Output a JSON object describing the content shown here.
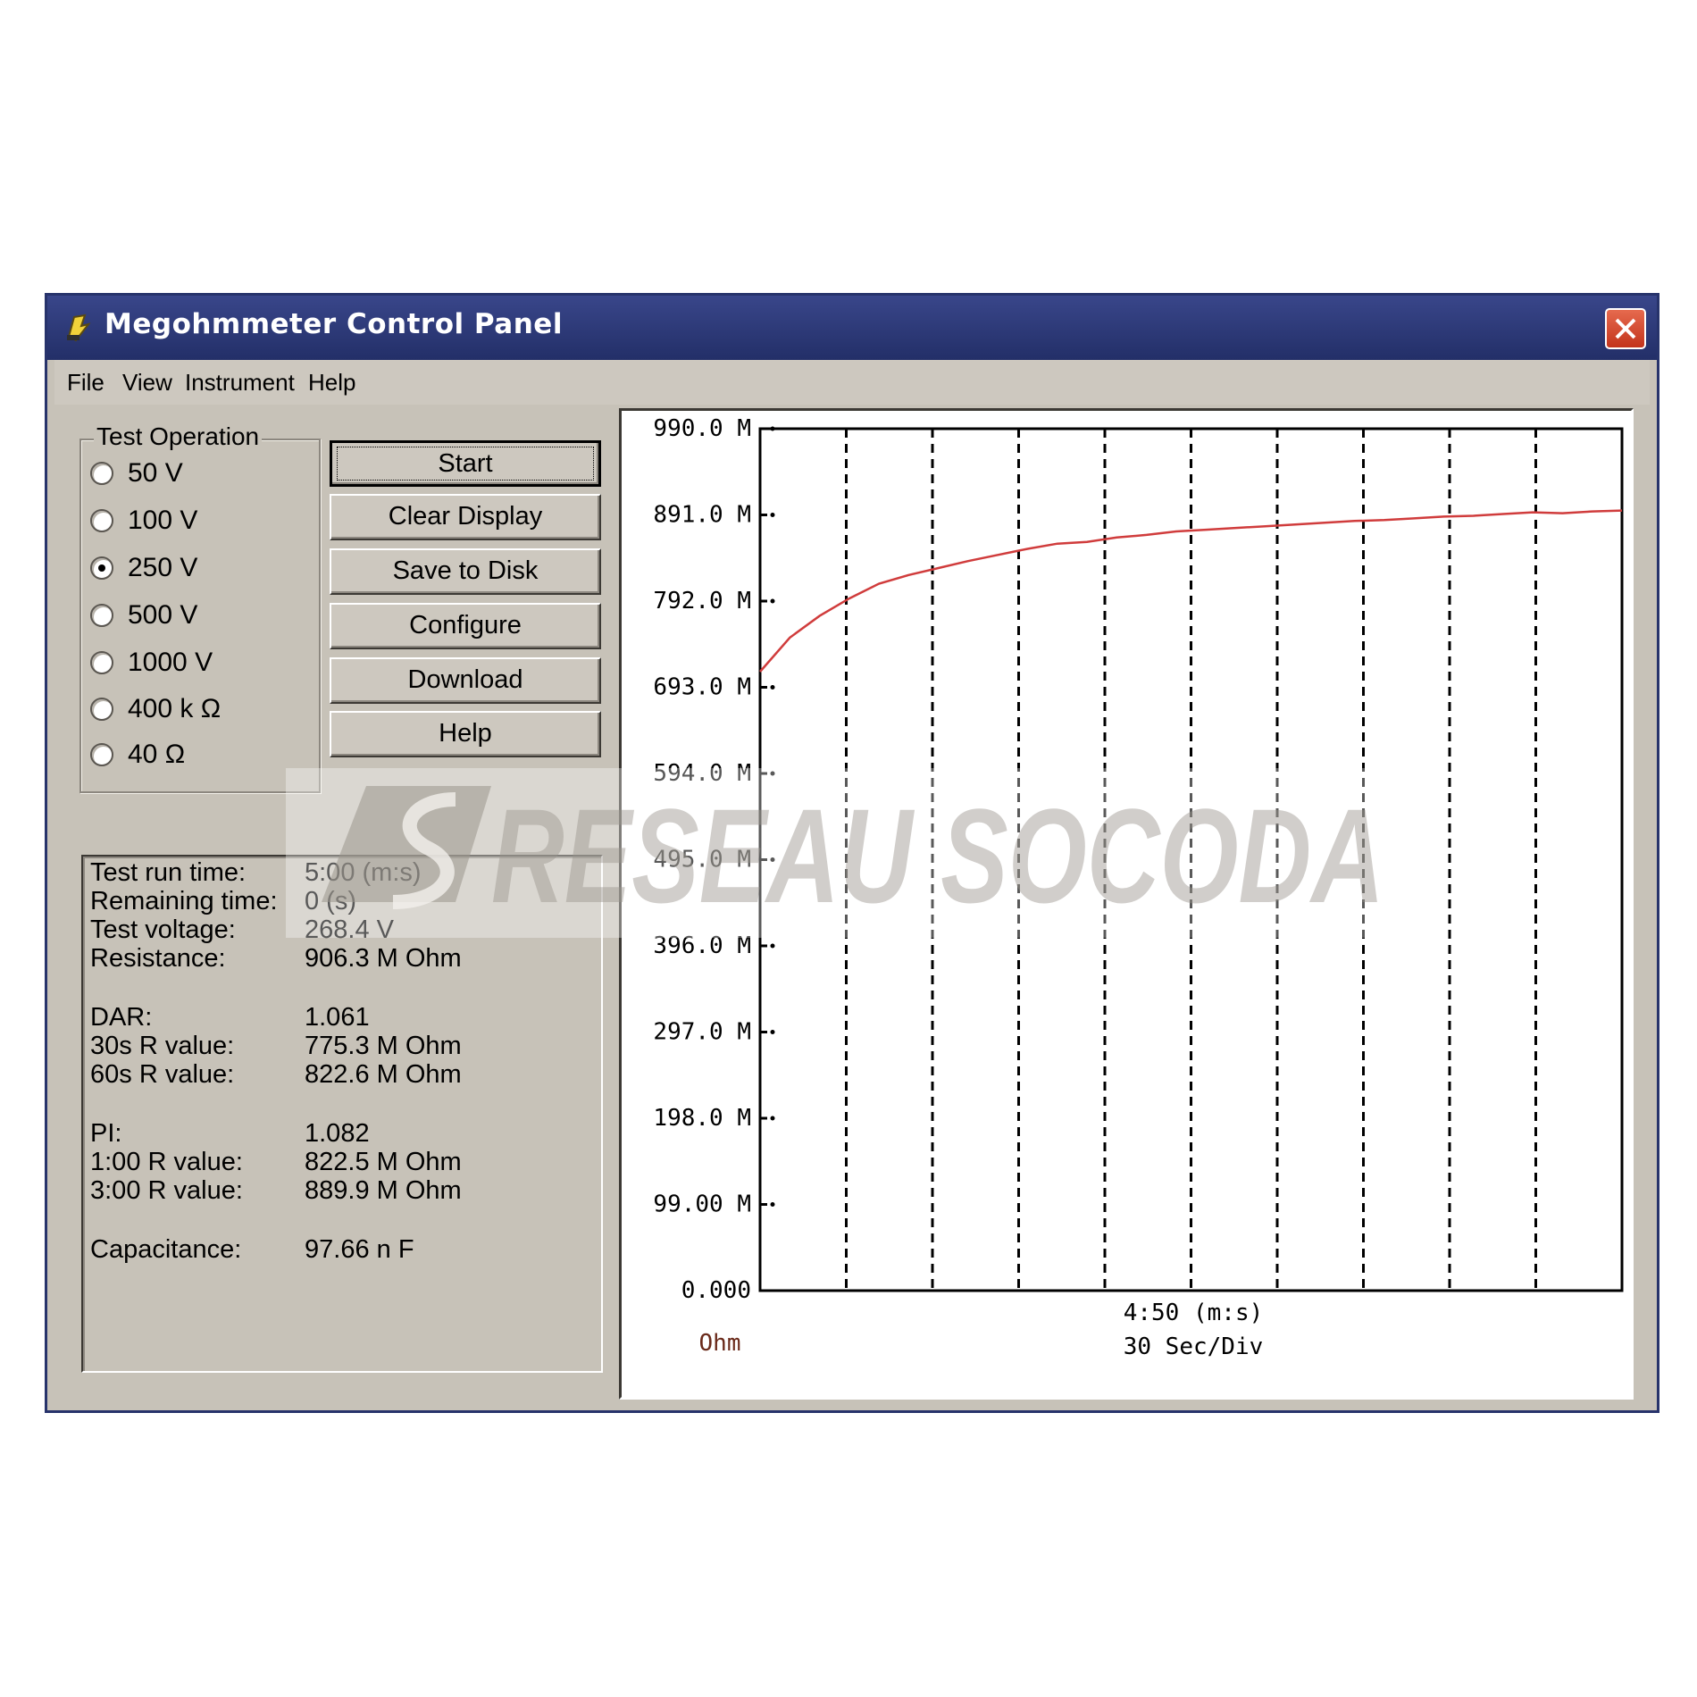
{
  "window": {
    "title": "Megohmmeter Control Panel",
    "close_label": "✕"
  },
  "menu": {
    "items": [
      "File",
      "View",
      "Instrument",
      "Help"
    ]
  },
  "test_operation": {
    "legend": "Test Operation",
    "options": [
      "50 V",
      "100 V",
      "250 V",
      "500 V",
      "1000 V",
      "400 k Ω",
      "40 Ω"
    ],
    "selected": "250 V"
  },
  "buttons": {
    "start": "Start",
    "clear_display": "Clear Display",
    "save_to_disk": "Save to Disk",
    "configure": "Configure",
    "download": "Download",
    "help": "Help"
  },
  "results": {
    "test_run_time": {
      "label": "Test run time:",
      "value": "5:00 (m:s)"
    },
    "remaining_time": {
      "label": "Remaining time:",
      "value": "0 (s)"
    },
    "test_voltage": {
      "label": "Test voltage:",
      "value": "268.4  V"
    },
    "resistance": {
      "label": "Resistance:",
      "value": "906.3 M Ohm"
    },
    "dar": {
      "label": "DAR:",
      "value": "1.061"
    },
    "r30s": {
      "label": "30s R value:",
      "value": "775.3 M Ohm"
    },
    "r60s": {
      "label": "60s R value:",
      "value": "822.6 M Ohm"
    },
    "pi": {
      "label": "PI:",
      "value": "1.082"
    },
    "r1m": {
      "label": "1:00 R value:",
      "value": "822.5 M Ohm"
    },
    "r3m": {
      "label": "3:00 R value:",
      "value": "889.9 M Ohm"
    },
    "capacitance": {
      "label": "Capacitance:",
      "value": "97.66 n F"
    }
  },
  "watermark": {
    "text": "RESEAU SOCODA"
  },
  "colors": {
    "title_bar": "#27336b",
    "window_face": "#c7c2b8",
    "trace": "#d03c3c",
    "close_button": "#d4472b"
  },
  "chart_data": {
    "type": "line",
    "y_tick_labels": [
      "990.0 M",
      "891.0 M",
      "792.0 M",
      "693.0 M",
      "594.0 M",
      "495.0 M",
      "396.0 M",
      "297.0 M",
      "198.0 M",
      "99.00 M",
      "0.000"
    ],
    "y_unit_label": "Ohm",
    "x_label": "4:50 (m:s)",
    "x_scale_label": "30 Sec/Div",
    "ylim": [
      0,
      990
    ],
    "xlim": [
      0,
      290
    ],
    "x_divisions": 10,
    "grid": "vertical dashed",
    "series": [
      {
        "color": "#d03c3c",
        "x": [
          0,
          10,
          20,
          30,
          40,
          50,
          60,
          70,
          80,
          90,
          100,
          110,
          120,
          130,
          140,
          150,
          160,
          170,
          180,
          190,
          200,
          210,
          220,
          230,
          240,
          250,
          260,
          270,
          280,
          290
        ],
        "y": [
          711,
          750,
          775,
          795,
          812,
          822,
          830,
          838,
          845,
          852,
          858,
          860,
          865,
          868,
          872,
          874,
          876,
          878,
          880,
          882,
          884,
          885,
          887,
          889,
          890,
          892,
          894,
          893,
          895,
          896
        ]
      }
    ]
  }
}
